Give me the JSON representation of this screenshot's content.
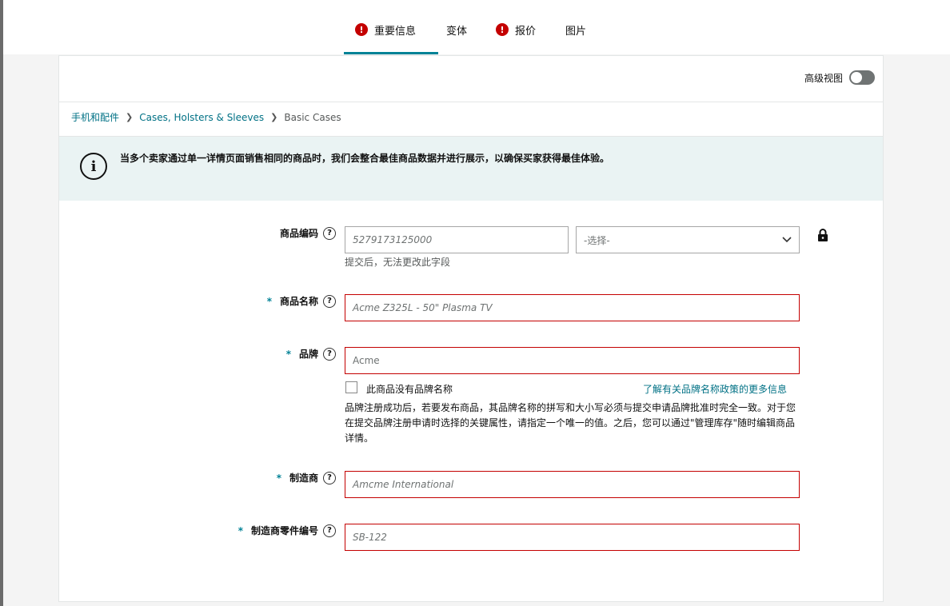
{
  "tabs": [
    {
      "label": "重要信息",
      "error": true,
      "active": true
    },
    {
      "label": "变体",
      "error": false,
      "active": false
    },
    {
      "label": "报价",
      "error": true,
      "active": false
    },
    {
      "label": "图片",
      "error": false,
      "active": false
    }
  ],
  "advanced_view": {
    "label": "高级视图",
    "enabled": false
  },
  "breadcrumb": {
    "items": [
      "手机和配件",
      "Cases, Holsters & Sleeves"
    ],
    "current": "Basic Cases"
  },
  "info": {
    "text": "当多个卖家通过单一详情页面销售相同的商品时，我们会整合最佳商品数据并进行展示，以确保买家获得最佳体验。"
  },
  "fields": {
    "product_id": {
      "label": "商品编码",
      "value": "5279173125000",
      "select_value": "-选择-",
      "hint": "提交后，无法更改此字段"
    },
    "product_name": {
      "label": "商品名称",
      "required": "*",
      "placeholder": "Acme Z325L - 50\" Plasma TV"
    },
    "brand": {
      "label": "品牌",
      "required": "*",
      "value": "Acme",
      "no_brand_label": "此商品没有品牌名称",
      "learn_more": "了解有关品牌名称政策的更多信息",
      "note": "品牌注册成功后，若要发布商品，其品牌名称的拼写和大小写必须与提交申请品牌批准时完全一致。对于您在提交品牌注册申请时选择的关键属性，请指定一个唯一的值。之后，您可以通过\"管理库存\"随时编辑商品详情。"
    },
    "manufacturer": {
      "label": "制造商",
      "required": "*",
      "placeholder": "Amcme International"
    },
    "part_number": {
      "label": "制造商零件编号",
      "required": "*",
      "placeholder": "SB-122"
    }
  },
  "colors": {
    "accent": "#008296",
    "error": "#c40000",
    "link": "#007185",
    "info_bg": "#eaf3f3"
  },
  "icons": [
    "error-icon",
    "help-icon",
    "info-icon",
    "lock-icon",
    "chevron-down-icon",
    "chevron-right-icon"
  ]
}
